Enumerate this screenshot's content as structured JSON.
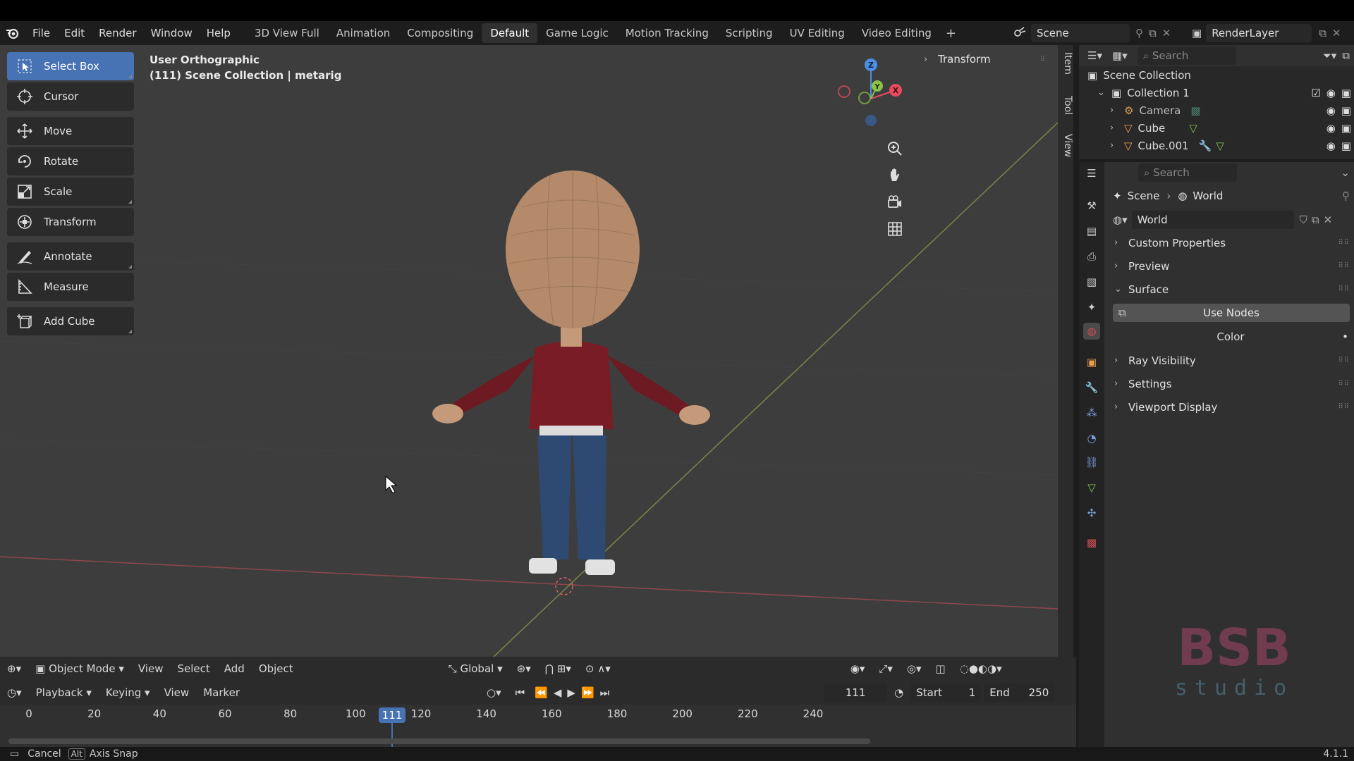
{
  "menu": {
    "items": [
      "File",
      "Edit",
      "Render",
      "Window",
      "Help"
    ],
    "workspaces": [
      "3D View Full",
      "Animation",
      "Compositing",
      "Default",
      "Game Logic",
      "Motion Tracking",
      "Scripting",
      "UV Editing",
      "Video Editing"
    ],
    "active_workspace": "Default",
    "scene": "Scene",
    "render_layer": "RenderLayer"
  },
  "viewport": {
    "view_name": "User Orthographic",
    "collection_info": "(111) Scene Collection | metarig",
    "panel_header": "Transform",
    "side_tabs": [
      "Item",
      "Tool",
      "View"
    ]
  },
  "toolbar": {
    "tools": [
      {
        "label": "Select Box",
        "icon": "select-box-icon",
        "active": true
      },
      {
        "label": "Cursor",
        "icon": "cursor-icon"
      },
      {
        "label": "Move",
        "icon": "move-icon"
      },
      {
        "label": "Rotate",
        "icon": "rotate-icon"
      },
      {
        "label": "Scale",
        "icon": "scale-icon"
      },
      {
        "label": "Transform",
        "icon": "transform-icon"
      },
      {
        "label": "Annotate",
        "icon": "annotate-icon"
      },
      {
        "label": "Measure",
        "icon": "measure-icon"
      },
      {
        "label": "Add Cube",
        "icon": "add-cube-icon"
      }
    ]
  },
  "gizmo": {
    "x": "X",
    "y": "Y",
    "z": "Z"
  },
  "vp_header": {
    "mode": "Object Mode",
    "menus": [
      "View",
      "Select",
      "Add",
      "Object"
    ],
    "orientation": "Global"
  },
  "timeline": {
    "menus": [
      "Playback",
      "Keying",
      "View",
      "Marker"
    ],
    "current_frame": "111",
    "start_label": "Start",
    "start": "1",
    "end_label": "End",
    "end": "250",
    "ticks": [
      "0",
      "20",
      "40",
      "60",
      "80",
      "100",
      "120",
      "140",
      "160",
      "180",
      "200",
      "220",
      "240"
    ]
  },
  "status": {
    "cancel": "Cancel",
    "alt_key": "Alt",
    "axis_snap": "Axis Snap",
    "version": "4.1.1"
  },
  "outliner": {
    "search_placeholder": "Search",
    "root": "Scene Collection",
    "collection": "Collection 1",
    "objects": [
      "Camera",
      "Cube",
      "Cube.001"
    ]
  },
  "properties": {
    "search_placeholder": "Search",
    "breadcrumb_scene": "Scene",
    "breadcrumb_world": "World",
    "world_name": "World",
    "panels_top": [
      "Custom Properties",
      "Preview"
    ],
    "surface": "Surface",
    "use_nodes": "Use Nodes",
    "color_label": "Color",
    "panels_bottom": [
      "Ray Visibility",
      "Settings",
      "Viewport Display"
    ]
  },
  "watermark": {
    "line1": "BSB",
    "line2": "studio"
  },
  "colors": {
    "accent": "#4772b3",
    "viewport_bg": "#3d3d3d",
    "x_axis": "#e84a5f",
    "y_axis": "#8bc34a",
    "z_axis": "#4d8fe0"
  }
}
